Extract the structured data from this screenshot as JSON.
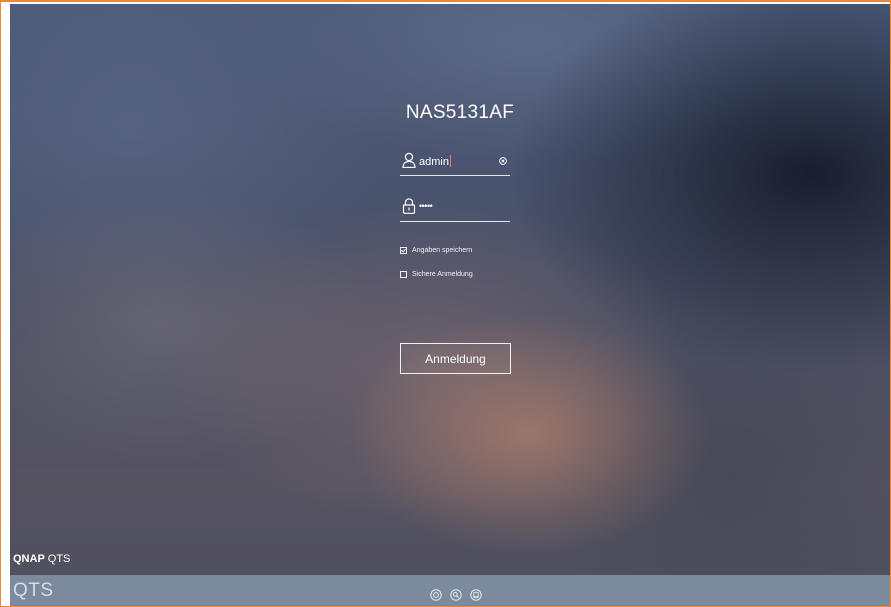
{
  "login": {
    "device_name": "NAS5131AF",
    "username_value": "admin",
    "password_mask": "•••••",
    "remember_label": "Angaben speichern",
    "remember_checked": true,
    "secure_label": "Sichere Anmeldung",
    "secure_checked": false,
    "submit_label": "Anmeldung"
  },
  "branding": {
    "company": "QNAP",
    "product": "QTS",
    "footer_logo": "QTS"
  },
  "footer": {
    "icons": [
      "qfinder-icon",
      "search-icon",
      "mobile-app-icon"
    ]
  },
  "colors": {
    "window_border": "#e98a3b",
    "footer_bar": "#7c8a9e",
    "text": "#ffffff"
  }
}
